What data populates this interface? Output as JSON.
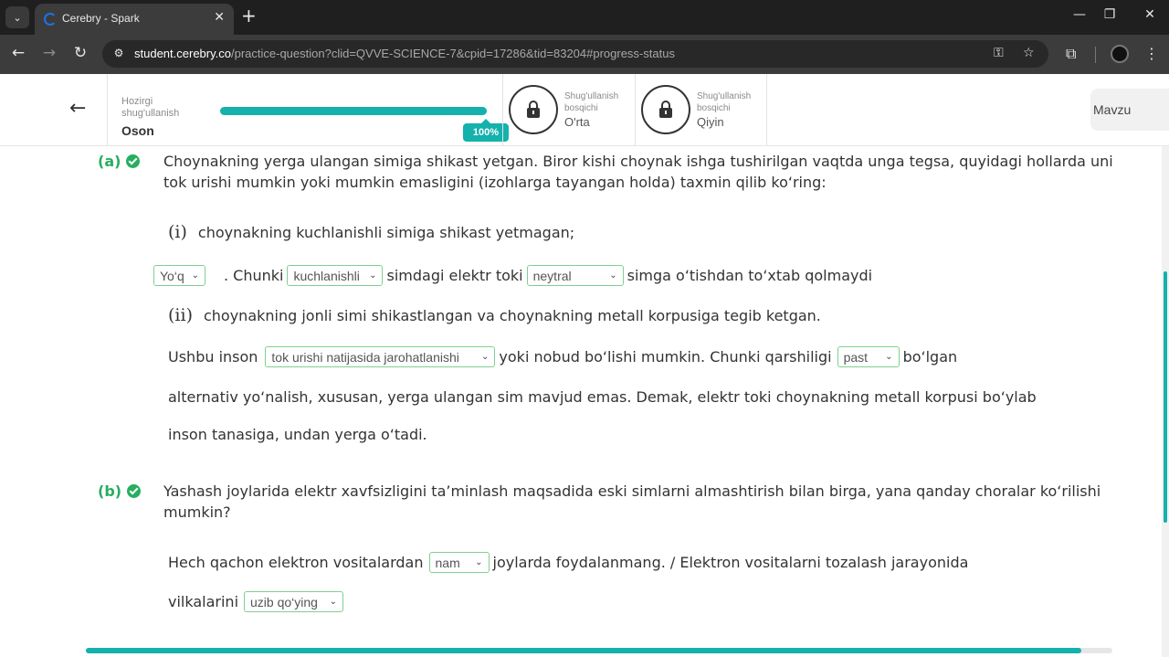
{
  "browser": {
    "tab_title": "Cerebry - Spark",
    "url_host": "student.cerebry.co",
    "url_path": "/practice-question?clid=QVVE-SCIENCE-7&cpid=17286&tid=83204#progress-status"
  },
  "header": {
    "current_label": "Hozirgi shug'ullanish",
    "current_level": "Oson",
    "progress_percent": 100,
    "progress_badge": "100%",
    "stages": [
      {
        "label": "Shug'ullanish bosqichi",
        "name": "O'rta",
        "locked": true
      },
      {
        "label": "Shug'ullanish bosqichi",
        "name": "Qiyin",
        "locked": true
      }
    ],
    "topic_button": "Mavzu"
  },
  "question_a": {
    "label": "(a)",
    "text": "Choynakning yerga ulangan simiga shikast yetgan. Biror kishi choynak ishga tushirilgan vaqtda unga tegsa, quyidagi hollarda uni tok urishi mumkin yoki mumkin emasligini (izohlarga tayangan holda) taxmin qilib ko‘ring:",
    "sub_i": {
      "numeral": "(i)",
      "text": "choynakning kuchlanishli simiga shikast yetmagan;",
      "answer": "Yo‘q",
      "t1": ". Chunki",
      "dd1": "kuchlanishli",
      "t2": "simdagi elektr toki",
      "dd2": "neytral",
      "t3": "simga o‘tishdan to‘xtab qolmaydi"
    },
    "sub_ii": {
      "numeral": "(ii)",
      "text": "choynakning jonli simi shikastlangan va choynakning metall korpusiga tegib ketgan.",
      "t1": "Ushbu inson",
      "dd1": "tok urishi natijasida jarohatlanishi",
      "t2": "yoki nobud bo‘lishi mumkin. Chunki qarshiligi",
      "dd2": "past",
      "t3": "bo‘lgan",
      "t4": "alternativ yo‘nalish, xususan, yerga ulangan sim mavjud emas. Demak, elektr toki choynakning metall korpusi bo‘ylab",
      "t5": "inson tanasiga, undan yerga o‘tadi."
    }
  },
  "question_b": {
    "label": "(b)",
    "text": "Yashash joylarida elektr xavfsizligini ta’minlash maqsadida eski simlarni almashtirish bilan birga, yana qanday choralar ko‘rilishi mumkin?",
    "t1": "Hech qachon elektron vositalardan",
    "dd1": "nam",
    "t2": "joylarda foydalanmang. / Elektron vositalarni tozalash jarayonida",
    "t3": "vilkalarini",
    "dd2": "uzib qo‘ying"
  },
  "overall_progress_percent": 97
}
